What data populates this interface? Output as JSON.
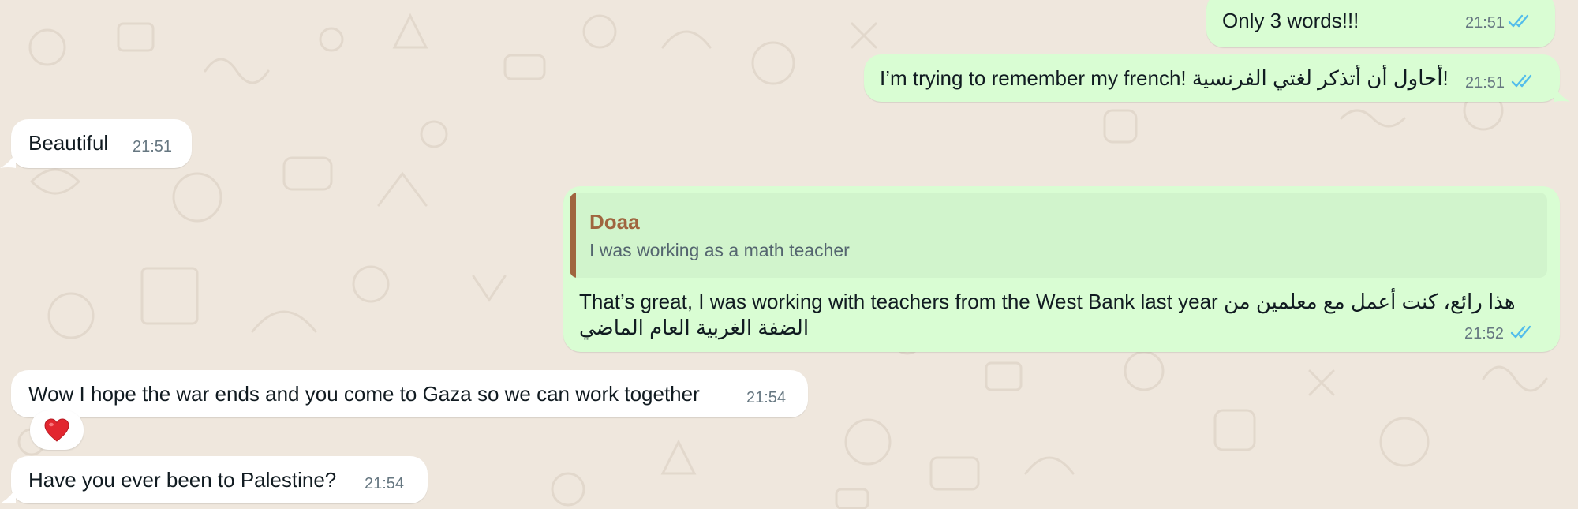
{
  "chat": {
    "messages": [
      {
        "direction": "outgoing",
        "text": "Only 3 words!!!",
        "time": "21:51",
        "status": "read"
      },
      {
        "direction": "outgoing",
        "text": "I’m trying to remember my french! أحاول أن أتذكر لغتي الفرنسية!",
        "time": "21:51",
        "status": "read"
      },
      {
        "direction": "incoming",
        "text": "Beautiful",
        "time": "21:51"
      },
      {
        "direction": "outgoing",
        "quote": {
          "author": "Doaa",
          "text": "I was working as a math teacher"
        },
        "text_line1": "That’s great, I was working with teachers from the West Bank last year هذا رائع، كنت أعمل مع معلمين من",
        "text_line2": "الضفة الغربية العام الماضي",
        "time": "21:52",
        "status": "read"
      },
      {
        "direction": "incoming",
        "text": "Wow I hope the war ends and you come to Gaza so we can work together",
        "time": "21:54",
        "reaction": "❤️"
      },
      {
        "direction": "incoming",
        "text": "Have you ever been to Palestine?",
        "time": "21:54"
      }
    ]
  },
  "colors": {
    "background": "#efe7dd",
    "outgoing_bubble": "#d9fdd3",
    "incoming_bubble": "#ffffff",
    "read_ticks": "#53bdeb",
    "quote_author": "#a0653f",
    "timestamp": "#667781"
  }
}
